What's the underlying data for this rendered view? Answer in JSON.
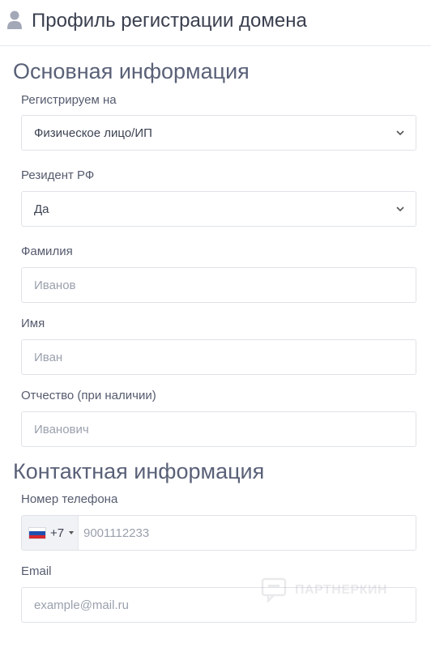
{
  "header": {
    "title": "Профиль регистрации домена",
    "icon": "user-icon"
  },
  "sections": {
    "basic": {
      "title": "Основная информация"
    },
    "contact": {
      "title": "Контактная информация"
    }
  },
  "fields": {
    "register_as": {
      "label": "Регистрируем на",
      "value": "Физическое лицо/ИП"
    },
    "resident": {
      "label": "Резидент РФ",
      "value": "Да"
    },
    "last_name": {
      "label": "Фамилия",
      "placeholder": "Иванов"
    },
    "first_name": {
      "label": "Имя",
      "placeholder": "Иван"
    },
    "middle_name": {
      "label": "Отчество (при наличии)",
      "placeholder": "Иванович"
    },
    "phone": {
      "label": "Номер телефона",
      "country_code": "+7",
      "placeholder": "9001112233",
      "flag": "russia-flag"
    },
    "email": {
      "label": "Email",
      "placeholder": "example@mail.ru"
    }
  },
  "watermark": {
    "text": "ПАРТНЕРКИН"
  },
  "colors": {
    "text": "#40475a",
    "section": "#5a6178",
    "border": "#dfe2e8",
    "placeholder": "#9aa0ad"
  }
}
